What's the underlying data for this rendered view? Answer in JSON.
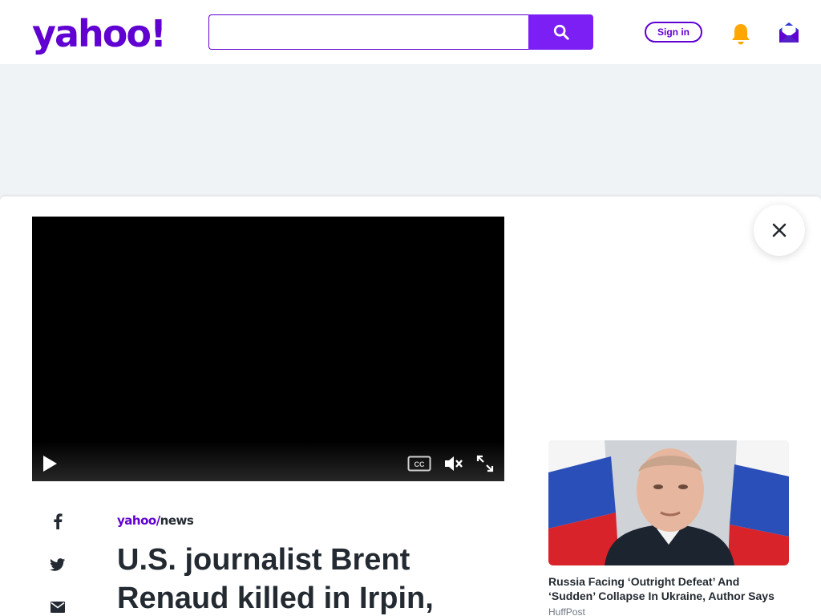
{
  "header": {
    "logo_text": "yahoo!",
    "search_value": "",
    "search_icon": "search-icon",
    "signin_label": "Sign in",
    "bell_icon": "bell-icon",
    "mail_icon": "mail-icon"
  },
  "video": {
    "play_icon": "play-icon",
    "cc_label": "CC",
    "mute_icon": "mute-icon",
    "fullscreen_icon": "fullscreen-icon"
  },
  "close_icon": "close-icon",
  "share": {
    "facebook_icon": "facebook-icon",
    "twitter_icon": "twitter-icon",
    "email_icon": "email-icon"
  },
  "article": {
    "brand_yahoo": "yahoo/",
    "brand_news": "news",
    "headline": "U.S. journalist Brent Renaud killed in Irpin,"
  },
  "story": {
    "title": "Russia Facing ‘Outright Defeat’ And ‘Sudden’ Collapse In Ukraine, Author Says",
    "source": "HuffPost"
  },
  "colors": {
    "brand": "#6001d2",
    "search_button": "#7b1ff5",
    "bell": "#ffa700",
    "headline": "#232a31",
    "page_bg": "#f0f3f5"
  }
}
